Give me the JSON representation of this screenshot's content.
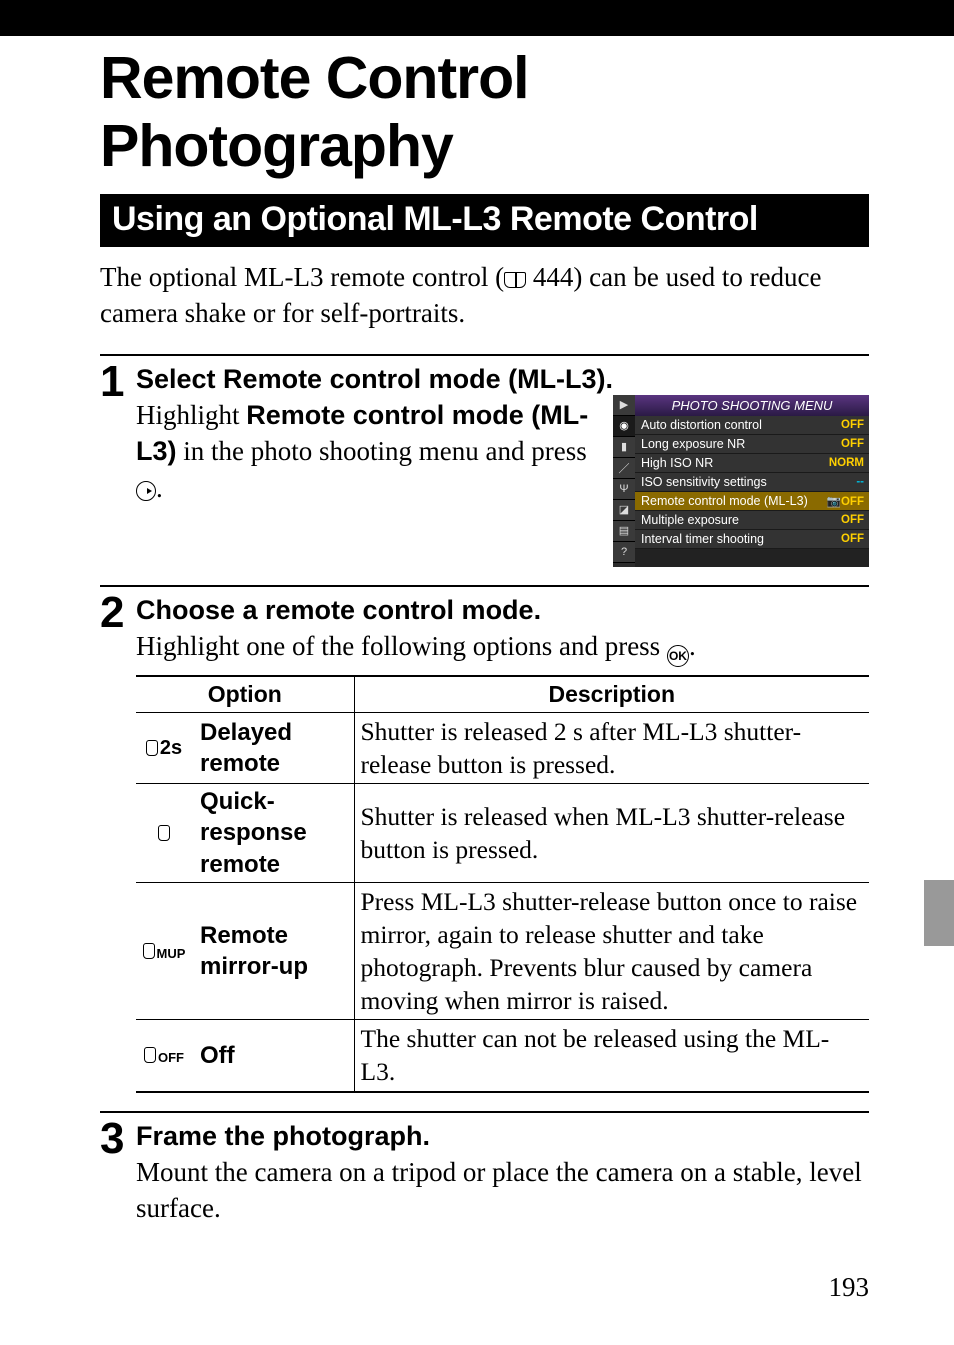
{
  "page_title": "Remote Control Photography",
  "section_title": "Using an Optional ML-L3 Remote Control",
  "intro_a": "The optional ML-L3 remote control (",
  "intro_ref": "444) can be used to reduce camera shake or for self-portraits.",
  "step1": {
    "num": "1",
    "heading": "Select Remote control mode (ML-L3).",
    "line_a": "Highlight ",
    "bold": "Remote control mode (ML-L3)",
    "line_b": " in the photo shooting menu and press ",
    "line_c": "."
  },
  "camera_menu": {
    "title": "PHOTO SHOOTING MENU",
    "rows": [
      {
        "label": "Auto distortion control",
        "value": "OFF"
      },
      {
        "label": "Long exposure NR",
        "value": "OFF"
      },
      {
        "label": "High ISO NR",
        "value": "NORM"
      },
      {
        "label": "ISO sensitivity settings",
        "value": "--",
        "dash": true
      },
      {
        "label": "Remote control mode (ML-L3)",
        "value": "OFF",
        "hl": true,
        "icon": true
      },
      {
        "label": "Multiple exposure",
        "value": "OFF"
      },
      {
        "label": "Interval timer shooting",
        "value": "OFF"
      }
    ],
    "tabs": [
      "▶",
      "◉",
      "▮",
      "／",
      "Ψ",
      "◪",
      "▤",
      "?"
    ]
  },
  "step2": {
    "num": "2",
    "heading": "Choose a remote control mode.",
    "text_a": "Highlight one of the following options and press ",
    "text_b": "."
  },
  "table": {
    "headers": [
      "Option",
      "Description"
    ],
    "rows": [
      {
        "icon": "2s",
        "label": "Delayed remote",
        "desc": "Shutter is released 2 s after ML-L3 shutter-release button is pressed."
      },
      {
        "icon": "",
        "label": "Quick-response remote",
        "desc": "Shutter is released when ML-L3 shutter-release button is pressed."
      },
      {
        "icon": "MUP",
        "label": "Remote mirror-up",
        "desc": "Press ML-L3 shutter-release button once to raise mirror, again to release shutter and take photograph.  Prevents blur caused by camera moving when mirror is raised."
      },
      {
        "icon": "OFF",
        "label": "Off",
        "desc": "The shutter can not be released using the ML-L3."
      }
    ]
  },
  "step3": {
    "num": "3",
    "heading": "Frame the photograph.",
    "text": "Mount the camera on a tripod or place the camera on a stable, level surface."
  },
  "page_number": "193"
}
